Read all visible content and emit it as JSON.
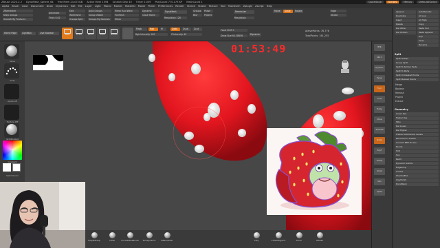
{
  "titlebar": {
    "items": [
      "ZBrush 2023.2.2",
      "DynaMesh_Sphere_64",
      "Free Mem 24.072GB",
      "Active Mem 1594",
      "Scratch Disk 40",
      "Timer 0.009",
      "PolyCount 770.175 KP",
      "MeshCount 1"
    ],
    "right": [
      "QuickSave",
      "Scripts",
      "Menus",
      "DefaultZScript"
    ]
  },
  "menubar": [
    "Alpha",
    "Brush",
    "Color",
    "Document",
    "Draw",
    "Dynamics",
    "Edit",
    "File",
    "Layer",
    "Light",
    "Macro",
    "Marker",
    "Material",
    "Movie",
    "Picker",
    "Preferences",
    "Render",
    "Stencil",
    "Stroke",
    "Texture",
    "Tool",
    "Transform",
    "Zplugin",
    "Zscript",
    "Help"
  ],
  "toppal": {
    "col1": [
      "ZRemesher",
      "Keep Groups",
      "Smooth By Features"
    ],
    "col2": [
      "Decimate",
      "Thick 0.02"
    ],
    "col3": [
      "Edit",
      "Wireframe",
      "Groups Split"
    ],
    "col4": [
      "Auto Groups",
      "Group Visible",
      "Groups By Normals"
    ],
    "col5": [
      "Mirror And Weld",
      "Fix Mesh",
      "Mirror"
    ],
    "col6": [
      "Dynamic",
      "Close Holes"
    ],
    "col7": [
      "DynaMesh",
      "Resolution 128"
    ],
    "col8": [
      "Groups",
      "Polish",
      "Blur",
      "Project"
    ],
    "col9": [
      "Remesher",
      "Resolution"
    ],
    "col10": [
      "Move",
      "Scale",
      "Rotate"
    ],
    "col11": [
      "Edge",
      "Stroke"
    ]
  },
  "toolrow": {
    "buttons": [
      "Home Page",
      "LightBox",
      "Live Boolean",
      "Edit",
      "Draw",
      "Move",
      "Scale",
      "Rotate"
    ],
    "mode": [
      "Mrgb",
      "Rgb",
      "M"
    ],
    "zadd": [
      "Zadd",
      "Zsub",
      "Zcut"
    ],
    "intensity": [
      "Rgb Intensity 100",
      "Z Intensity 40"
    ],
    "focal": [
      "Focal Shift 0",
      "Draw Size 64.38856",
      "Dynamic"
    ],
    "stats": [
      "ActivePoints: 76,776",
      "TotalPoints: 161,255"
    ],
    "persp": [
      "Persp",
      "Floor",
      "Local"
    ]
  },
  "timer": "01:53:49",
  "leftshelf": {
    "brushes": [
      "Move",
      "Standard",
      "Dots",
      "Alpha Off",
      "Texture Off",
      "SkinShade4"
    ],
    "color_label": "Gradient",
    "switch_label": "SwitchColor"
  },
  "bottombar": [
    "ClayBuildup",
    "Inflat",
    "CurvePlaneBrush",
    "TrimDynamic",
    "ZRemesher",
    "Clay",
    "ChiselOrganic",
    "Pinch",
    "hPolish"
  ],
  "rightdock": [
    "BPR",
    "SPix 3",
    "Dynamic",
    "Persp",
    "Floor",
    "Local",
    "Frame",
    "Move",
    "Zoom3D",
    "Rotate",
    "PolyF",
    "Transp",
    "Ghost",
    "Solo",
    "Xpose"
  ],
  "rightpanel": {
    "top_rows": [
      "Append",
      "Duplicate",
      "Insert",
      "Delete",
      "Del Other",
      "Del Hidden"
    ],
    "split_header": "Split",
    "split_rows": [
      "Split Hidden",
      "Group Split",
      "Split To Similar Parts",
      "Split To Parts",
      "Split Unmasked Points",
      "Split Masked Points"
    ],
    "merge_rows": [
      "Merge",
      "Boolean",
      "Remesh",
      "Project",
      "Extract"
    ],
    "geometry_header": "Geometry",
    "geometry_rows": [
      "Lower Res",
      "Higher Res",
      "SDiv",
      "Del Lower",
      "Del Higher",
      "Freeze SubDivision Levels",
      "Reconstruct Subdiv",
      "Convert BPR To Geo",
      "Divide",
      "Smt",
      "Suv",
      "ReUV",
      "Dynamic Subdiv",
      "EdgeLoop",
      "Crease",
      "ShadowBox",
      "ClayPolish",
      "DynaMesh"
    ],
    "right_col": [
      "AutoReorder",
      "All Low",
      "All High",
      "Copy",
      "Paste Tool",
      "Paste Append",
      "Dup",
      "Clear",
      "Rename"
    ]
  },
  "colors": {
    "accent": "#d9741a",
    "timer": "#ff2a2a",
    "mushroom": "#e3161f"
  }
}
